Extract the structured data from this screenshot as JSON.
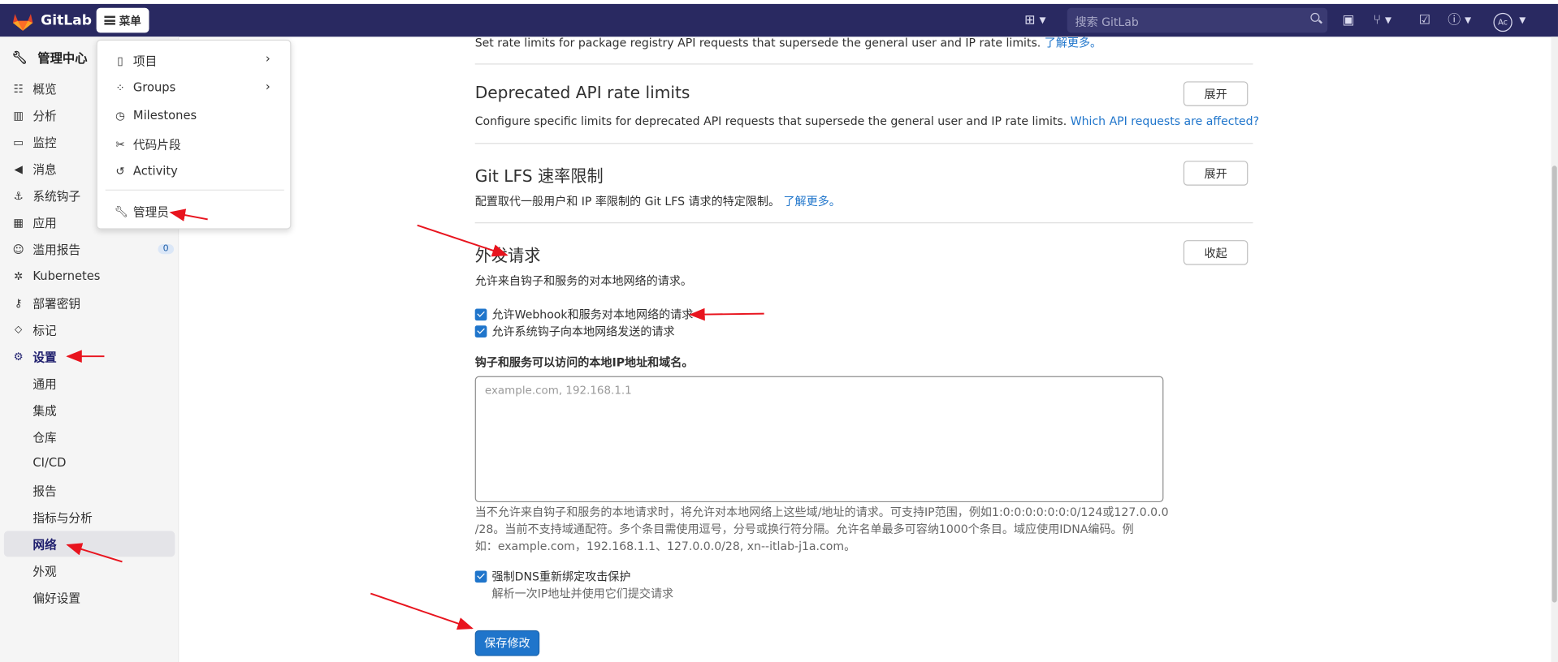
{
  "topbar": {
    "brand": "GitLab",
    "menu_label": "菜单",
    "search_placeholder": "搜索 GitLab",
    "avatar_initials": "Ac",
    "colors": {
      "bar": "#292961",
      "accent": "#1f75cb"
    }
  },
  "dropdown": {
    "items": [
      {
        "label": "项目",
        "icon": "project-icon",
        "submenu": true
      },
      {
        "label": "Groups",
        "icon": "group-icon",
        "submenu": true
      },
      {
        "label": "Milestones",
        "icon": "clock-icon",
        "submenu": false
      },
      {
        "label": "代码片段",
        "icon": "scissors-icon",
        "submenu": false
      },
      {
        "label": "Activity",
        "icon": "history-icon",
        "submenu": false
      },
      {
        "label": "管理员",
        "icon": "wrench-icon",
        "submenu": false
      }
    ]
  },
  "sidebar": {
    "header": "管理中心",
    "items": [
      {
        "label": "概览",
        "icon": "overview-icon"
      },
      {
        "label": "分析",
        "icon": "chart-icon"
      },
      {
        "label": "监控",
        "icon": "monitor-icon"
      },
      {
        "label": "消息",
        "icon": "bullhorn-icon"
      },
      {
        "label": "系统钩子",
        "icon": "anchor-icon"
      },
      {
        "label": "应用",
        "icon": "apps-icon"
      },
      {
        "label": "滥用报告",
        "icon": "emoji-icon",
        "badge": "0"
      },
      {
        "label": "Kubernetes",
        "icon": "kubernetes-icon"
      },
      {
        "label": "部署密钥",
        "icon": "key-icon"
      },
      {
        "label": "标记",
        "icon": "label-icon"
      },
      {
        "label": "设置",
        "icon": "gear-icon"
      }
    ],
    "settings_sub": [
      "通用",
      "集成",
      "仓库",
      "CI/CD",
      "报告",
      "指标与分析",
      "网络",
      "外观",
      "偏好设置"
    ],
    "active_sub": "网络"
  },
  "main": {
    "top_line": "Set rate limits for package registry API requests that supersede the general user and IP rate limits.",
    "top_link": "了解更多。",
    "sections": [
      {
        "title": "Deprecated API rate limits",
        "desc": "Configure specific limits for deprecated API requests that supersede the general user and IP rate limits.",
        "link": "Which API requests are affected?",
        "button": "展开"
      },
      {
        "title": "Git LFS 速率限制",
        "desc": "配置取代一般用户和 IP 率限制的 Git LFS 请求的特定限制。",
        "link": "了解更多。",
        "button": "展开"
      },
      {
        "title": "外发请求",
        "desc": "允许来自钩子和服务的对本地网络的请求。",
        "link": "",
        "button": "收起"
      }
    ],
    "checkbox_webhook": "允许Webhook和服务对本地网络的请求",
    "checkbox_systemhook": "允许系统钩子向本地网络发送的请求",
    "allowlist_label": "钩子和服务可以访问的本地IP地址和域名。",
    "allowlist_placeholder": "example.com, 192.168.1.1",
    "help_line1": "当不允许来自钩子和服务的本地请求时，将允许对本地网络上这些域/地址的请求。可支持IP范围，例如1:0:0:0:0:0:0:0/124或127.0.0.0",
    "help_line2": "/28。当前不支持域通配符。多个条目需使用逗号，分号或换行符分隔。允许名单最多可容纳1000个条目。域应使用IDNA编码。例",
    "help_line3": "如：example.com，192.168.1.1、127.0.0.0/28, xn--itlab-j1a.com。",
    "dns_checkbox": "强制DNS重新绑定攻击保护",
    "dns_help": "解析一次IP地址并使用它们提交请求",
    "save_button": "保存修改"
  }
}
